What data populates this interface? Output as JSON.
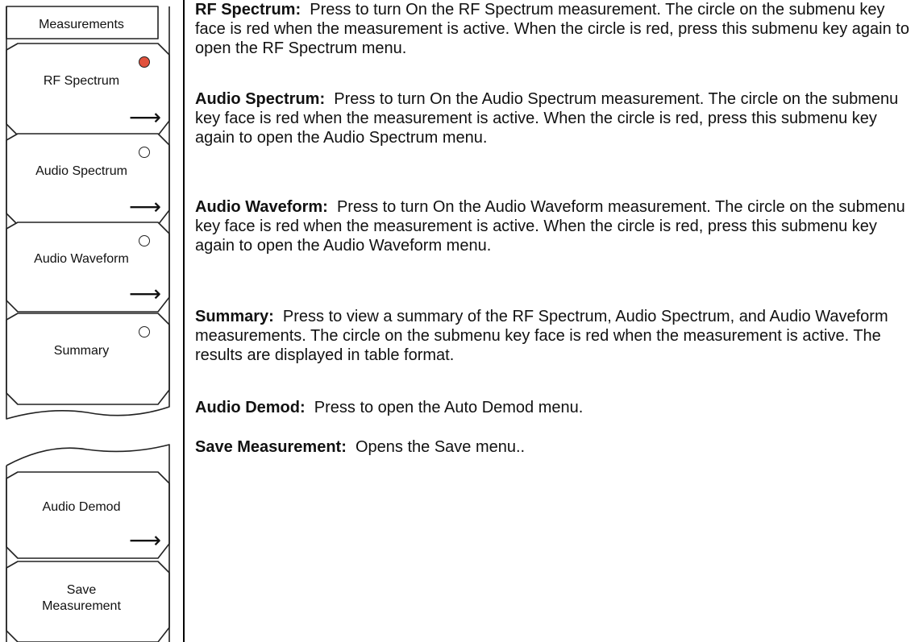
{
  "menu": {
    "title": "Measurements",
    "active_color": "#e1523d",
    "keys": [
      {
        "label": "RF Spectrum",
        "indicator": true,
        "active": true,
        "arrow": true
      },
      {
        "label": "Audio Spectrum",
        "indicator": true,
        "active": false,
        "arrow": true
      },
      {
        "label": "Audio Waveform",
        "indicator": true,
        "active": false,
        "arrow": true
      },
      {
        "label": "Summary",
        "indicator": true,
        "active": false,
        "arrow": false
      },
      {
        "label": "Audio Demod",
        "indicator": false,
        "active": false,
        "arrow": true
      },
      {
        "label": "Save\nMeasurement",
        "indicator": false,
        "active": false,
        "arrow": false
      }
    ],
    "arrow_glyph": "⟶"
  },
  "descriptions": [
    {
      "term": "RF Spectrum:",
      "text": "Press to turn On the RF Spectrum measurement. The circle on the submenu key face is red when the measurement is active. When the circle is red, press this submenu key again to open the RF Spectrum menu."
    },
    {
      "term": "Audio Spectrum:",
      "text": "Press to turn On the Audio Spectrum measurement. The circle on the submenu key face is red when the measurement is active. When the circle is red, press this submenu key again to open the Audio Spectrum menu."
    },
    {
      "term": "Audio Waveform:",
      "text": "Press to turn On the Audio Waveform measurement. The circle on the submenu key face is red when the measurement is active. When the circle is red, press this submenu key again to open the Audio Waveform menu."
    },
    {
      "term": "Summary:",
      "text": "Press to view a summary of the RF Spectrum, Audio Spectrum, and Audio Waveform measurements. The circle on the submenu key face is red when the measurement is active. The results are displayed in table format."
    },
    {
      "term": "Audio Demod:",
      "text": "Press to open the Auto Demod menu."
    },
    {
      "term": "Save Measurement:",
      "text": "Opens the Save menu.."
    }
  ]
}
